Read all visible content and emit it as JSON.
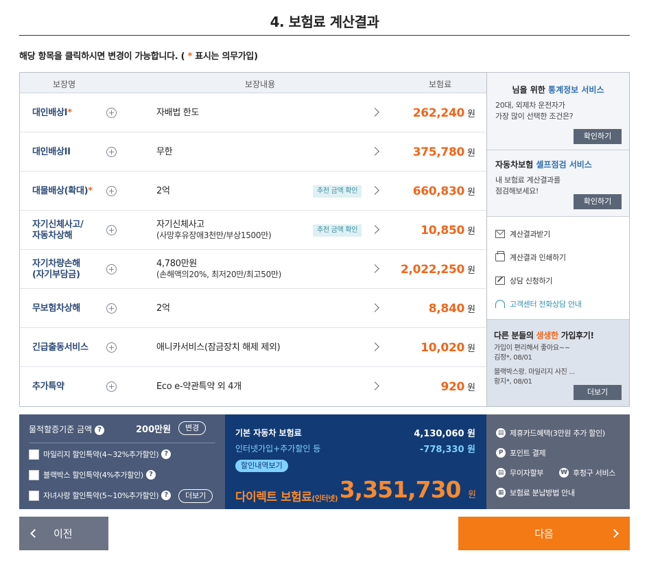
{
  "page_title": "4. 보험료 계산결과",
  "notice": {
    "pre": "해당 항목을 클릭하시면 변경이 가능합니다. ( ",
    "star": "*",
    "post": " 표시는 의무가입)"
  },
  "table": {
    "headers": {
      "name": "보장명",
      "content": "보장내용",
      "premium": "보험료"
    },
    "recommend_label": "추천 금액 확인",
    "won": "원",
    "rows": [
      {
        "name": "대인배상I",
        "required": "*",
        "content": "자배법 한도",
        "sub": "",
        "amount": "262,240",
        "recommend": false
      },
      {
        "name": "대인배상II",
        "required": "",
        "content": "무한",
        "sub": "",
        "amount": "375,780",
        "recommend": false
      },
      {
        "name": "대물배상(확대)",
        "required": "*",
        "content": "2억",
        "sub": "",
        "amount": "660,830",
        "recommend": true
      },
      {
        "name": "자기신체사고/\n자동차상해",
        "required": "",
        "content": "자기신체사고",
        "sub": "(사망후유장애3천만/부상1500만)",
        "amount": "10,850",
        "recommend": true
      },
      {
        "name": "자기차량손해\n(자기부담금)",
        "required": "",
        "content": "4,780만원",
        "sub": "(손해액의20%, 최저20만/최고50만)",
        "amount": "2,022,250",
        "recommend": false
      },
      {
        "name": "무보험차상해",
        "required": "",
        "content": "2억",
        "sub": "",
        "amount": "8,840",
        "recommend": false
      },
      {
        "name": "긴급출동서비스",
        "required": "",
        "content": "애니카서비스(잠금장치 해제 제외)",
        "sub": "",
        "amount": "10,020",
        "recommend": false
      },
      {
        "name": "추가특약",
        "required": "",
        "content": "Eco e-약관특약 외 4개",
        "sub": "",
        "amount": "920",
        "recommend": false
      }
    ]
  },
  "side": {
    "stats": {
      "title_pre": "님을 위한 ",
      "title_blue": "통계정보 서비스",
      "desc1": "20대, 외제차 운전자가",
      "desc2": "가장 많이 선택한 조건은?",
      "button": "확인하기"
    },
    "self_check": {
      "title_pre": "자동차보험 ",
      "title_blue": "셀프점검 서비스",
      "desc1": "내 보험료 계산결과를",
      "desc2": "점검해보세요!",
      "button": "확인하기"
    },
    "links": [
      {
        "icon": "mail-icon",
        "label": "계산결과받기"
      },
      {
        "icon": "print-icon",
        "label": "계산결과 인쇄하기"
      },
      {
        "icon": "edit-icon",
        "label": "상담 신청하기"
      },
      {
        "icon": "headset-icon",
        "label": "고객센터 전화상담 안내"
      }
    ],
    "reviews": {
      "title_pre": "다른 분들의 ",
      "title_orange": "생생한",
      "title_post": " 가입후기!",
      "items": [
        {
          "text": "가입이 편리해서 좋아요~~",
          "meta": "김정*, 08/01"
        },
        {
          "text": "블랙박스랑. 마일리지 사진 ...",
          "meta": "황지*, 08/01"
        }
      ],
      "more": "더보기"
    }
  },
  "summary_left": {
    "label": "물적할증기준 금액",
    "amount": "200만원",
    "change": "변경",
    "checks": [
      {
        "label": "마일리지 할인특약(4~32%추가할인)"
      },
      {
        "label": "블랙박스 할인특약(4%추가할인)"
      },
      {
        "label": "자녀사랑 할인특약(5~10%추가할인)"
      }
    ],
    "more": "더보기",
    "help": "?"
  },
  "summary_mid": {
    "base_label": "기본 자동차 보험료",
    "base_amount": "4,130,060 원",
    "disc_label": "인터넷가입+추가할인 등",
    "disc_amount": "-778,330 원",
    "badge": "할인내역보기",
    "total_label": "다이렉트 보험료",
    "total_suffix": "(인터넷)",
    "total_amount": "3,351,730",
    "total_unit": "원"
  },
  "summary_right": {
    "items": [
      {
        "glyph": "▤",
        "label": "제휴카드혜택(3만원 추가 할인)"
      },
      {
        "glyph": "P",
        "label": "포인트 결제"
      },
      {
        "glyph": "▤",
        "label": "무이자할부"
      },
      {
        "glyph": "₩",
        "label": "후청구 서비스"
      },
      {
        "glyph": "▦",
        "label": "보험료 분납방법 안내"
      }
    ]
  },
  "nav": {
    "prev": "이전",
    "next": "다음"
  }
}
